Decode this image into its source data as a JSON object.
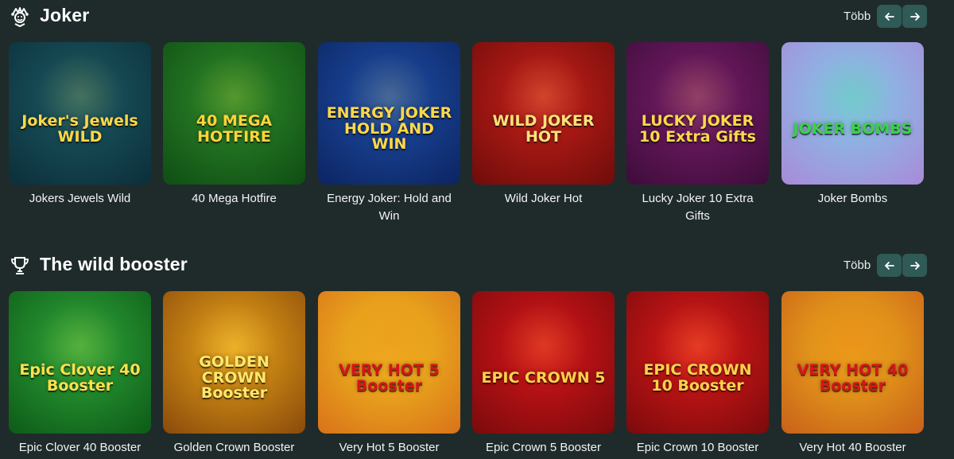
{
  "sections": [
    {
      "title": "Joker",
      "icon": "joker-icon",
      "more_label": "Több",
      "games": [
        {
          "title": "Jokers Jewels Wild",
          "art_text": "Joker's Jewels WILD",
          "bg": "#1b5a63",
          "bg2": "#0c2e3a",
          "fg": "#ffd84a"
        },
        {
          "title": "40 Mega Hotfire",
          "art_text": "40 MEGA HOTFIRE",
          "bg": "#2e8a2a",
          "bg2": "#0f4d14",
          "fg": "#ffd43a"
        },
        {
          "title": "Energy Joker: Hold and Win",
          "art_text": "ENERGY JOKER HOLD AND WIN",
          "bg": "#1e4fa8",
          "bg2": "#0c2461",
          "fg": "#ffd84a"
        },
        {
          "title": "Wild Joker Hot",
          "art_text": "WILD JOKER HOT",
          "bg": "#c8201a",
          "bg2": "#6e0c0a",
          "fg": "#ffe27a"
        },
        {
          "title": "Lucky Joker 10 Extra Gifts",
          "art_text": "LUCKY JOKER 10 Extra Gifts",
          "bg": "#7a1e6b",
          "bg2": "#3d0c3a",
          "fg": "#ffd84a"
        },
        {
          "title": "Joker Bombs",
          "art_text": "JOKER BOMBS",
          "bg": "#7fc9e8",
          "bg2": "#a98ad9",
          "fg": "#3bd14a"
        }
      ]
    },
    {
      "title": "The wild booster",
      "icon": "trophy-icon",
      "more_label": "Több",
      "games": [
        {
          "title": "Epic Clover 40 Booster",
          "art_text": "Epic Clover 40 Booster",
          "bg": "#2fa63a",
          "bg2": "#0d5a17",
          "fg": "#ffe04a"
        },
        {
          "title": "Golden Crown Booster",
          "art_text": "GOLDEN CROWN Booster",
          "bg": "#e8a41a",
          "bg2": "#8a4a0a",
          "fg": "#ffe86a"
        },
        {
          "title": "Very Hot 5 Booster",
          "art_text": "VERY HOT 5 Booster",
          "bg": "#f3c21e",
          "bg2": "#d8721a",
          "fg": "#d8141a"
        },
        {
          "title": "Epic Crown 5 Booster",
          "art_text": "EPIC CROWN 5",
          "bg": "#d8161a",
          "bg2": "#7a0a0c",
          "fg": "#ffd24a"
        },
        {
          "title": "Epic Crown 10 Booster",
          "art_text": "EPIC CROWN 10 Booster",
          "bg": "#e01a1a",
          "bg2": "#7a0a0c",
          "fg": "#ffd24a"
        },
        {
          "title": "Very Hot 40 Booster",
          "art_text": "VERY HOT 40 Booster",
          "bg": "#f0b21a",
          "bg2": "#c8601a",
          "fg": "#d8141a"
        }
      ]
    }
  ],
  "nav": {
    "prev_icon": "arrow-left-icon",
    "next_icon": "arrow-right-icon"
  }
}
